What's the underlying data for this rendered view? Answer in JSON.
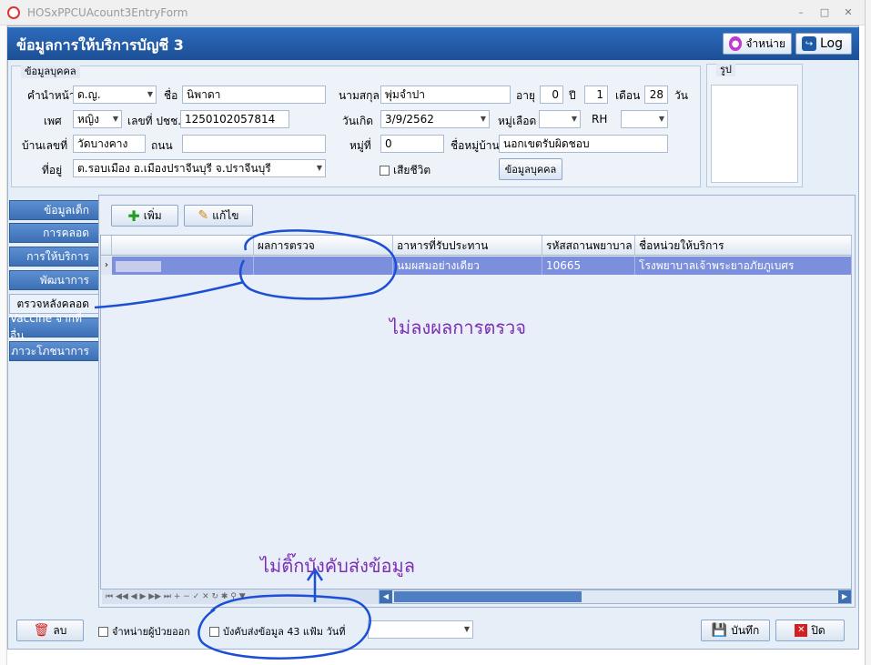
{
  "window": {
    "title": "HOSxPPCUAcount3EntryForm",
    "min": "–",
    "max": "□",
    "close": "✕"
  },
  "header": {
    "title": "ข้อมูลการให้บริการบัญชี 3",
    "discharge_btn": "จำหน่าย",
    "log_btn": "Log"
  },
  "person": {
    "legend": "ข้อมูลบุคคล",
    "prefix_label": "คำนำหน้า",
    "prefix": "ด.ญ.",
    "name_label": "ชื่อ",
    "name": "นิพาดา",
    "surname_label": "นามสกุล",
    "surname": "พุ่มจำปา",
    "age_label": "อายุ",
    "age_years": "0",
    "year_label": "ปี",
    "age_months": "1",
    "month_label": "เดือน",
    "age_days": "28",
    "day_label": "วัน",
    "sex_label": "เพศ",
    "sex": "หญิง",
    "cid_label": "เลขที่ ปชช.",
    "cid": "1250102057814",
    "birthdate_label": "วันเกิด",
    "birthdate": "3/9/2562",
    "blood_label": "หมู่เลือด",
    "blood": "",
    "rh_label": "RH",
    "rh": "",
    "house_no_label": "บ้านเลขที่",
    "house_no": "วัดบางคาง",
    "road_label": "ถนน",
    "road": "",
    "moo_label": "หมู่ที่",
    "moo": "0",
    "village_label": "ชื่อหมู่บ้าน",
    "village": "นอกเขตรับผิดชอบ",
    "address_label": "ที่อยู่",
    "address": "ต.รอบเมือง อ.เมืองปราจีนบุรี จ.ปราจีนบุรี",
    "deceased_label": "เสียชีวิต",
    "person_btn": "ข้อมูลบุคคล"
  },
  "photo": {
    "legend": "รูป"
  },
  "tabs": [
    "ข้อมูลเด็ก",
    "การคลอด",
    "การให้บริการ",
    "พัฒนาการ",
    "ตรวจหลังคลอด",
    "Vaccine จากที่อื่น",
    "ภาวะโภชนาการ"
  ],
  "toolbar": {
    "add": "เพิ่ม",
    "edit": "แก้ไข"
  },
  "grid": {
    "columns": [
      "",
      "ผลการตรวจ",
      "อาหารที่รับประทาน",
      "รหัสสถานพยาบาล",
      "ชื่อหน่วยให้บริการ"
    ],
    "rows": [
      [
        "",
        "",
        "นมผสมอย่างเดียว",
        "10665",
        "โรงพยาบาลเจ้าพระยาอภัยภูเบศร"
      ]
    ]
  },
  "nav": {
    "buttons": "⏮ ◀◀ ◀ ▶ ▶▶ ⏭ + − ✓ ✕ ↻ ✱ ⚲ ▼"
  },
  "footer": {
    "delete_btn": "ลบ",
    "discharge_check": "จำหน่ายผู้ป่วยออก",
    "force_send_check": "บังคับส่งข้อมูล 43 แฟ้ม วันที่",
    "force_send_date": "",
    "save_btn": "บันทึก",
    "close_btn": "ปิด"
  },
  "annotations": {
    "note1": "ไม่ลงผลการตรวจ",
    "note2": "ไม่ติ๊กบังคับส่งข้อมูล"
  },
  "colors": {
    "header": "#1f5aa6",
    "selected_row": "#7c8fdc",
    "annotation_ink": "#1a4fd6",
    "annotation_text": "#7a2fb5"
  }
}
